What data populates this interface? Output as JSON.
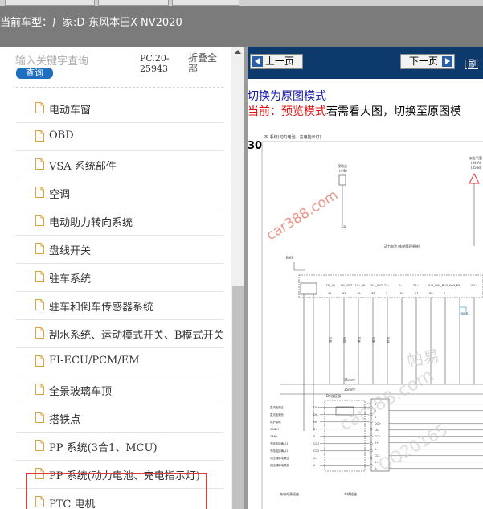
{
  "header": {
    "vehicle_label": "当前车型：",
    "vehicle_value": "厂家:D-东风本田X-NV2020"
  },
  "sidebar": {
    "search_placeholder": "输入关键字查询",
    "query_button": "查询",
    "doc_code": "PC.20-25943",
    "collapse_all": "折叠全部",
    "items": [
      {
        "label": "电动车窗"
      },
      {
        "label": "OBD"
      },
      {
        "label": "VSA 系统部件"
      },
      {
        "label": "空调"
      },
      {
        "label": "电动助力转向系统"
      },
      {
        "label": "盘线开关"
      },
      {
        "label": "驻车系统"
      },
      {
        "label": "驻车和倒车传感器系统"
      },
      {
        "label": "刮水系统、运动模式开关、B模式开关"
      },
      {
        "label": "FI-ECU/PCM/EM"
      },
      {
        "label": "全景玻璃车顶"
      },
      {
        "label": "搭铁点"
      },
      {
        "label": "PP 系统(3合1、MCU)"
      },
      {
        "label": "PP 系统(动力电池、充电指示灯)"
      },
      {
        "label": "PTC 电机"
      }
    ],
    "highlight_color": "#e03a3a"
  },
  "viewer": {
    "prev_button": "上一页",
    "next_button": "下一页",
    "refresh_link": "[刷",
    "switch_link": "切换为原图模式",
    "mode_current": "当前：预览模式",
    "mode_hint": "若需看大图，切换至原图模",
    "diagram": {
      "page_number": "30",
      "title": "PP 系统(动力电池、充电指示灯)",
      "watermark_main": "car388.com",
      "watermark_faint_1": "帕易",
      "watermark_faint_2": "car388.com",
      "watermark_faint_3": "QQ20165",
      "label_bms": "BMS",
      "label_section": "动力电池 (电池管理系统)",
      "label_dc_connector": "DC连接器",
      "label_wire_size": "35mm²",
      "pins_top": [
        "FC-_IN",
        "FC-_OUT",
        "FC+_IN",
        "FC+_OUT",
        "T1+",
        "T-",
        "T2+",
        "CH3_CAN_H",
        "CH3_CAN_L",
        "C2",
        "CA+"
      ],
      "pin_numbers": [
        "15",
        "31",
        "16",
        "32",
        "5",
        "29",
        "27",
        "28",
        "9"
      ],
      "left_labels": [
        "直流电源正",
        "直流电源负",
        "保护接地",
        "CAN H",
        "CAN L",
        "充电连接确认1",
        "充电连接确认2",
        "低压辅助电源正",
        "低压辅助电源负"
      ],
      "left_pins": [
        "DC+",
        "DC-",
        "PE",
        "S+",
        "S-",
        "CC1",
        "CC2",
        "A+",
        "A-"
      ],
      "right_pins": [
        "1",
        "2",
        "3",
        "DC+",
        "DC-",
        "CC2",
        "S+",
        "S-",
        "CC1",
        "A+",
        "A-"
      ],
      "bottom_labels": [
        "充电电源插座",
        "车辆插座"
      ],
      "wire_colors": [
        "蓝色",
        "绿色",
        "黄色",
        "紫色",
        "粉色"
      ],
      "right_label_1": "安全气囊",
      "right_label_2": "(34-A)",
      "right_label_3": "(35-B)",
      "fuse_label": "保险丝",
      "fuse_pins": "(4-B)",
      "ground_label": "+B",
      "ref_label": "G261",
      "width_label": "6mm²"
    }
  }
}
